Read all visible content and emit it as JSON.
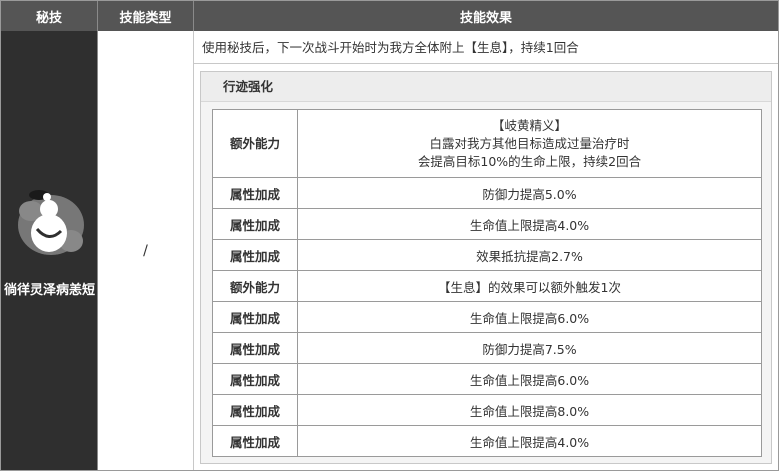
{
  "headers": {
    "skill": "秘技",
    "type": "技能类型",
    "effect": "技能效果"
  },
  "skill": {
    "name": "徜徉灵泽病恙短",
    "type": "/"
  },
  "effect": {
    "description": "使用秘技后，下一次战斗开始时为我方全体附上【生息】，持续1回合"
  },
  "trace": {
    "title": "行迹强化",
    "rows": [
      {
        "label": "额外能力",
        "lines": [
          "【岐黄精义】",
          "白露对我方其他目标造成过量治疗时",
          "会提高目标10%的生命上限，持续2回合"
        ]
      },
      {
        "label": "属性加成",
        "lines": [
          "防御力提高5.0%"
        ]
      },
      {
        "label": "属性加成",
        "lines": [
          "生命值上限提高4.0%"
        ]
      },
      {
        "label": "属性加成",
        "lines": [
          "效果抵抗提高2.7%"
        ]
      },
      {
        "label": "额外能力",
        "lines": [
          "【生息】的效果可以额外触发1次"
        ]
      },
      {
        "label": "属性加成",
        "lines": [
          "生命值上限提高6.0%"
        ]
      },
      {
        "label": "属性加成",
        "lines": [
          "防御力提高7.5%"
        ]
      },
      {
        "label": "属性加成",
        "lines": [
          "生命值上限提高6.0%"
        ]
      },
      {
        "label": "属性加成",
        "lines": [
          "生命值上限提高8.0%"
        ]
      },
      {
        "label": "属性加成",
        "lines": [
          "生命值上限提高4.0%"
        ]
      }
    ]
  }
}
